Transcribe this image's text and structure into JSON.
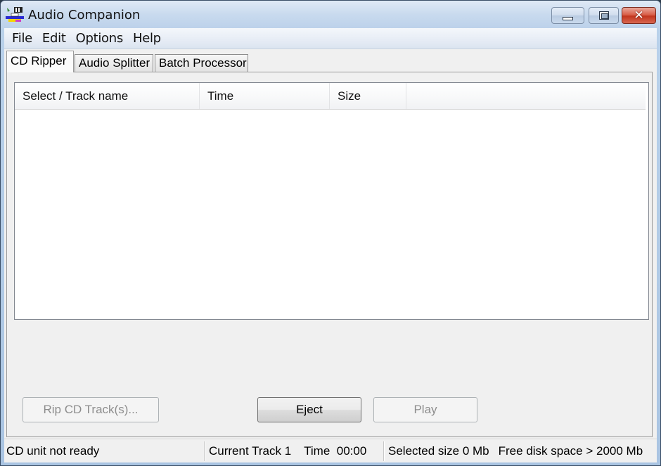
{
  "window": {
    "title": "Audio Companion",
    "app_icon": "audio-companion-icon",
    "controls": {
      "minimize": "minimize-icon",
      "maximize": "maximize-icon",
      "close": "close-icon"
    }
  },
  "menubar": {
    "items": [
      {
        "label": "File"
      },
      {
        "label": "Edit"
      },
      {
        "label": "Options"
      },
      {
        "label": "Help"
      }
    ]
  },
  "tabs": [
    {
      "label": "CD Ripper",
      "active": true
    },
    {
      "label": "Audio Splitter",
      "active": false
    },
    {
      "label": "Batch Processor",
      "active": false
    }
  ],
  "track_list": {
    "columns": [
      {
        "label": "Select / Track name"
      },
      {
        "label": "Time"
      },
      {
        "label": "Size"
      }
    ],
    "rows": []
  },
  "buttons": {
    "rip": {
      "label": "Rip CD Track(s)...",
      "enabled": false
    },
    "eject": {
      "label": "Eject",
      "enabled": true
    },
    "play": {
      "label": "Play",
      "enabled": false
    }
  },
  "statusbar": {
    "cd_status": "CD unit not ready",
    "current_track": "Current Track 1",
    "time": "Time  00:00",
    "selected_size": "Selected size 0 Mb",
    "free_disk_space": "Free disk space > 2000 Mb"
  }
}
